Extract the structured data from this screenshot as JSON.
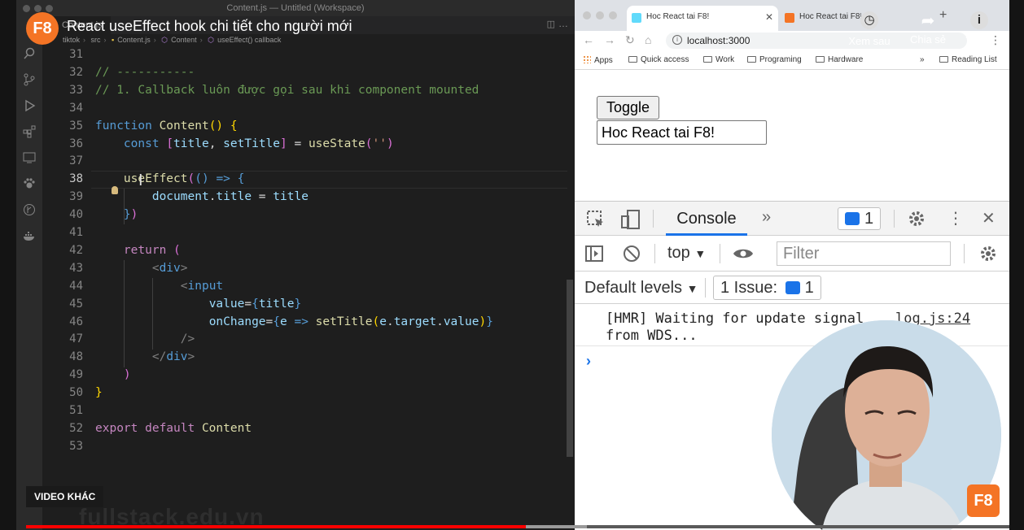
{
  "video": {
    "channel_logo": "F8",
    "title": "React useEffect hook chi tiết cho người mới",
    "watch_later": "Xem sau",
    "share": "Chia sẻ",
    "info": "Thô...",
    "other_videos": "VIDEO KHÁC",
    "watermark": "fullstack.edu.vn",
    "progress_fraction": 0.508,
    "buffer_fraction": 0.57
  },
  "vscode": {
    "window_title": "Content.js — Untitled (Workspace)",
    "tab_label": "Content.js",
    "breadcrumb": [
      "tiktok",
      "src",
      "Content.js",
      "Content",
      "useEffect() callback"
    ],
    "active_line": 38,
    "lines": [
      {
        "n": 31,
        "tokens": []
      },
      {
        "n": 32,
        "tokens": [
          {
            "t": "// -----------",
            "c": "com"
          }
        ]
      },
      {
        "n": 33,
        "tokens": [
          {
            "t": "// 1. Callback luôn được gọi sau khi component mounted",
            "c": "com"
          }
        ]
      },
      {
        "n": 34,
        "tokens": []
      },
      {
        "n": 35,
        "tokens": [
          {
            "t": "function ",
            "c": "kw"
          },
          {
            "t": "Content",
            "c": "fn"
          },
          {
            "t": "() ",
            "c": "br"
          },
          {
            "t": "{",
            "c": "br"
          }
        ]
      },
      {
        "n": 36,
        "tokens": [
          {
            "t": "    ",
            "c": "pun"
          },
          {
            "t": "const ",
            "c": "kw"
          },
          {
            "t": "[",
            "c": "br2"
          },
          {
            "t": "title",
            "c": "var"
          },
          {
            "t": ", ",
            "c": "pun"
          },
          {
            "t": "setTitle",
            "c": "var"
          },
          {
            "t": "]",
            "c": "br2"
          },
          {
            "t": " = ",
            "c": "pun"
          },
          {
            "t": "useState",
            "c": "fn"
          },
          {
            "t": "(",
            "c": "br2"
          },
          {
            "t": "''",
            "c": "str"
          },
          {
            "t": ")",
            "c": "br2"
          }
        ]
      },
      {
        "n": 37,
        "tokens": []
      },
      {
        "n": 38,
        "tokens": [
          {
            "t": "    ",
            "c": "pun"
          },
          {
            "t": "useEffect",
            "c": "fn"
          },
          {
            "t": "(",
            "c": "br2"
          },
          {
            "t": "() ",
            "c": "kw"
          },
          {
            "t": "=> ",
            "c": "kw"
          },
          {
            "t": "{",
            "c": "kw"
          }
        ]
      },
      {
        "n": 39,
        "tokens": [
          {
            "t": "        ",
            "c": "pun"
          },
          {
            "t": "document",
            "c": "var"
          },
          {
            "t": ".",
            "c": "pun"
          },
          {
            "t": "title",
            "c": "var"
          },
          {
            "t": " = ",
            "c": "pun"
          },
          {
            "t": "title",
            "c": "var"
          }
        ]
      },
      {
        "n": 40,
        "tokens": [
          {
            "t": "    ",
            "c": "pun"
          },
          {
            "t": "}",
            "c": "kw"
          },
          {
            "t": ")",
            "c": "br2"
          }
        ]
      },
      {
        "n": 41,
        "tokens": []
      },
      {
        "n": 42,
        "tokens": [
          {
            "t": "    ",
            "c": "pun"
          },
          {
            "t": "return ",
            "c": "kw2"
          },
          {
            "t": "(",
            "c": "br2"
          }
        ]
      },
      {
        "n": 43,
        "tokens": [
          {
            "t": "        ",
            "c": "pun"
          },
          {
            "t": "<",
            "c": "tagb"
          },
          {
            "t": "div",
            "c": "tag"
          },
          {
            "t": ">",
            "c": "tagb"
          }
        ]
      },
      {
        "n": 44,
        "tokens": [
          {
            "t": "            ",
            "c": "pun"
          },
          {
            "t": "<",
            "c": "tagb"
          },
          {
            "t": "input",
            "c": "tag"
          }
        ]
      },
      {
        "n": 45,
        "tokens": [
          {
            "t": "                ",
            "c": "pun"
          },
          {
            "t": "value",
            "c": "var"
          },
          {
            "t": "=",
            "c": "pun"
          },
          {
            "t": "{",
            "c": "kw"
          },
          {
            "t": "title",
            "c": "var"
          },
          {
            "t": "}",
            "c": "kw"
          }
        ]
      },
      {
        "n": 46,
        "tokens": [
          {
            "t": "                ",
            "c": "pun"
          },
          {
            "t": "onChange",
            "c": "var"
          },
          {
            "t": "=",
            "c": "pun"
          },
          {
            "t": "{",
            "c": "kw"
          },
          {
            "t": "e",
            "c": "var"
          },
          {
            "t": " => ",
            "c": "kw"
          },
          {
            "t": "setTitle",
            "c": "fn"
          },
          {
            "t": "(",
            "c": "br"
          },
          {
            "t": "e",
            "c": "var"
          },
          {
            "t": ".",
            "c": "pun"
          },
          {
            "t": "target",
            "c": "var"
          },
          {
            "t": ".",
            "c": "pun"
          },
          {
            "t": "value",
            "c": "var"
          },
          {
            "t": ")",
            "c": "br"
          },
          {
            "t": "}",
            "c": "kw"
          }
        ]
      },
      {
        "n": 47,
        "tokens": [
          {
            "t": "            ",
            "c": "pun"
          },
          {
            "t": "/>",
            "c": "tagb"
          }
        ]
      },
      {
        "n": 48,
        "tokens": [
          {
            "t": "        ",
            "c": "pun"
          },
          {
            "t": "</",
            "c": "tagb"
          },
          {
            "t": "div",
            "c": "tag"
          },
          {
            "t": ">",
            "c": "tagb"
          }
        ]
      },
      {
        "n": 49,
        "tokens": [
          {
            "t": "    ",
            "c": "pun"
          },
          {
            "t": ")",
            "c": "br2"
          }
        ]
      },
      {
        "n": 50,
        "tokens": [
          {
            "t": "}",
            "c": "br"
          }
        ]
      },
      {
        "n": 51,
        "tokens": []
      },
      {
        "n": 52,
        "tokens": [
          {
            "t": "export ",
            "c": "kw2"
          },
          {
            "t": "default ",
            "c": "kw2"
          },
          {
            "t": "Content",
            "c": "fn"
          }
        ]
      },
      {
        "n": 53,
        "tokens": []
      }
    ]
  },
  "browser": {
    "tabs": [
      {
        "label": "Hoc React tai F8!",
        "active": true,
        "favicon_color": "#61dafb"
      },
      {
        "label": "Hoc React tai F8!",
        "active": false,
        "favicon_color": "#f47425"
      }
    ],
    "url": "localhost:3000",
    "bookmarks": [
      "Apps",
      "Quick access",
      "Work",
      "Programing",
      "Hardware"
    ],
    "reading_list": "Reading List",
    "page": {
      "toggle_label": "Toggle",
      "input_value": "Hoc React tai F8!"
    },
    "devtools": {
      "tab_console": "Console",
      "messages_count": "1",
      "context": "top",
      "filter_placeholder": "Filter",
      "levels": "Default levels",
      "issues_label": "1 Issue:",
      "issues_count": "1",
      "log_message": "[HMR] Waiting for update signal from WDS...",
      "log_source": "log.js:24"
    }
  },
  "colors": {
    "accent_orange": "#f47425",
    "progress_red": "#ff0000",
    "devtools_blue": "#1a73e8"
  }
}
